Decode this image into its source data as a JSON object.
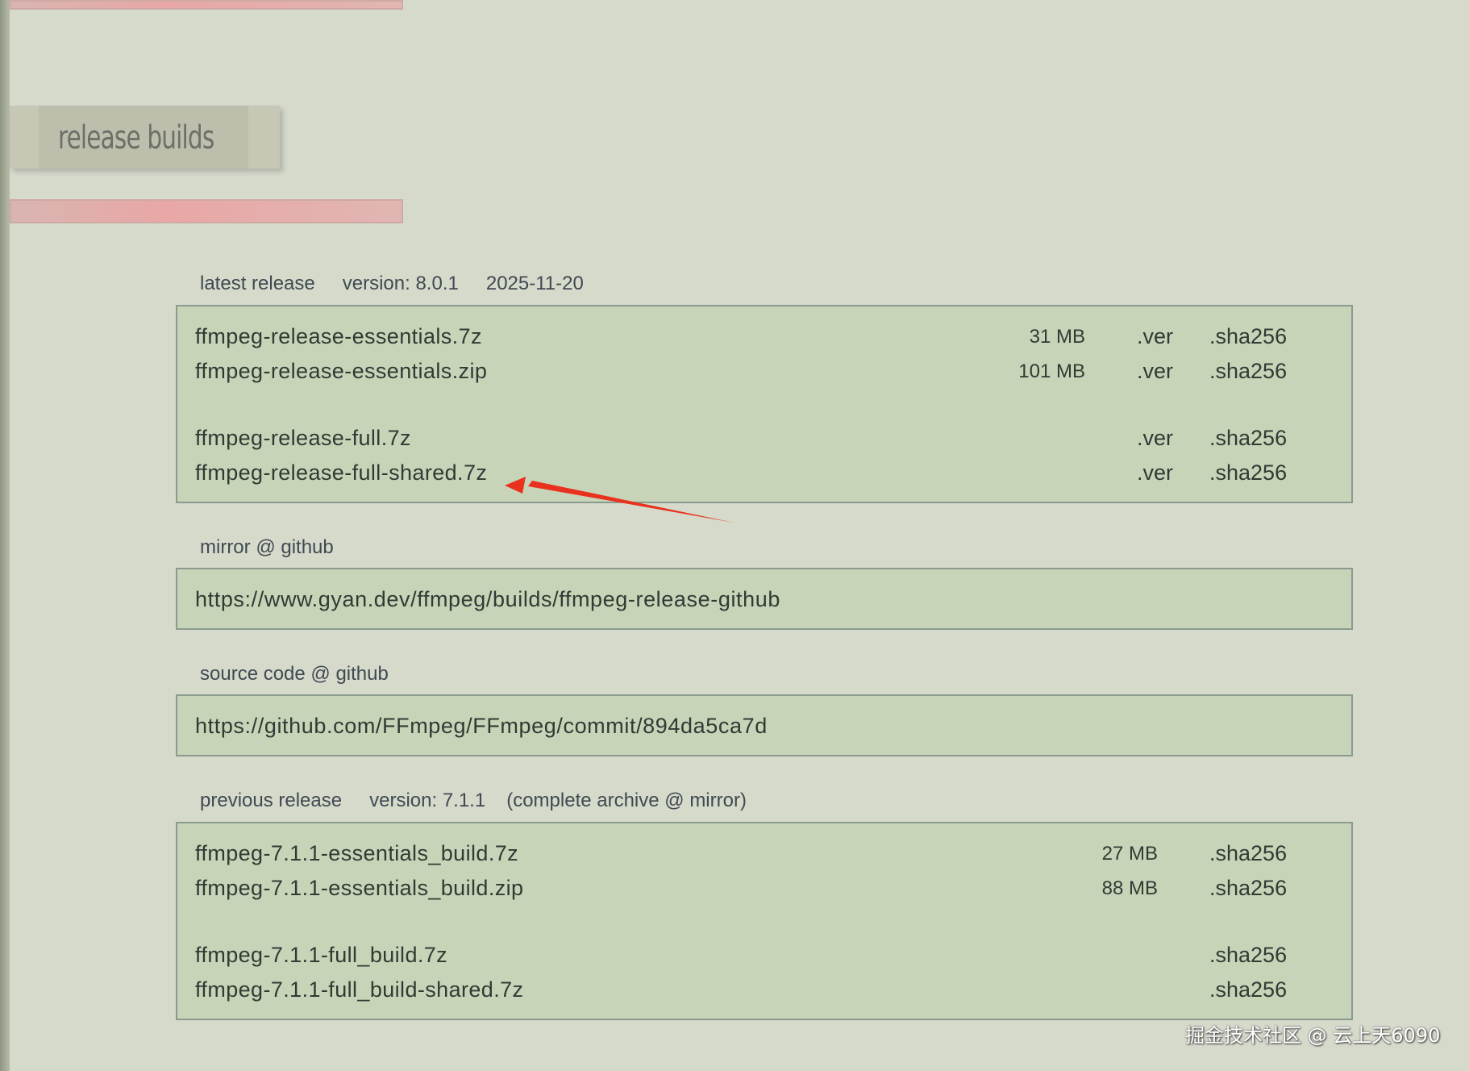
{
  "page": {
    "section_title": "release builds"
  },
  "latest": {
    "labels": [
      "latest release",
      "version: 8.0.1",
      "2025-11-20"
    ],
    "files": [
      {
        "name": "ffmpeg-release-essentials.7z",
        "size": "31 MB",
        "ver": ".ver",
        "sha": ".sha256"
      },
      {
        "name": "ffmpeg-release-essentials.zip",
        "size": "101 MB",
        "ver": ".ver",
        "sha": ".sha256"
      },
      {
        "name": "ffmpeg-release-full.7z",
        "size": "",
        "ver": ".ver",
        "sha": ".sha256"
      },
      {
        "name": "ffmpeg-release-full-shared.7z",
        "size": "",
        "ver": ".ver",
        "sha": ".sha256"
      }
    ]
  },
  "mirror": {
    "label": "mirror @ github",
    "url": "https://www.gyan.dev/ffmpeg/builds/ffmpeg-release-github"
  },
  "source": {
    "label": "source code @ github",
    "url": "https://github.com/FFmpeg/FFmpeg/commit/894da5ca7d"
  },
  "previous": {
    "labels": [
      "previous release",
      "version: 7.1.1",
      "(complete archive @ mirror)"
    ],
    "files": [
      {
        "name": "ffmpeg-7.1.1-essentials_build.7z",
        "size": "27 MB",
        "sha": ".sha256"
      },
      {
        "name": "ffmpeg-7.1.1-essentials_build.zip",
        "size": "88 MB",
        "sha": ".sha256"
      },
      {
        "name": "ffmpeg-7.1.1-full_build.7z",
        "size": "",
        "sha": ".sha256"
      },
      {
        "name": "ffmpeg-7.1.1-full_build-shared.7z",
        "size": "",
        "sha": ".sha256"
      }
    ]
  },
  "annotation": {
    "arrow_color": "#e8321e"
  },
  "watermark": "掘金技术社区 @ 云上天6090",
  "colors": {
    "background": "#d6dacb",
    "box_fill": "#c8d4b8",
    "pink_bar": "#e8a7a6"
  }
}
